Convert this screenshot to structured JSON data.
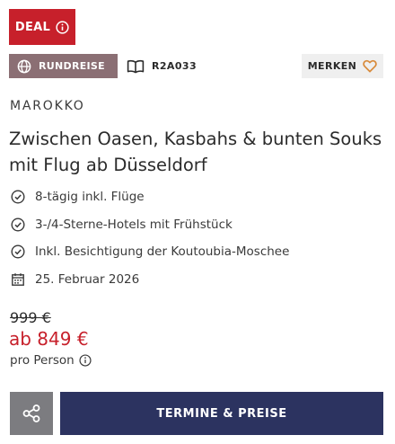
{
  "deal": {
    "label": "DEAL",
    "icon": "info-icon"
  },
  "tags": {
    "type_label": "RUNDREISE",
    "type_icon": "globe-icon",
    "code": "R2A033",
    "code_icon": "book-icon",
    "save_label": "MERKEN",
    "save_icon": "heart-icon"
  },
  "trip": {
    "country": "MAROKKO",
    "title": "Zwischen Oasen, Kasbahs & bunten Souks mit Flug ab Düsseldorf",
    "features": [
      {
        "icon": "check-circle-icon",
        "text": "8-tägig inkl. Flüge"
      },
      {
        "icon": "check-circle-icon",
        "text": "3-/4-Sterne-Hotels mit Frühstück"
      },
      {
        "icon": "check-circle-icon",
        "text": "Inkl. Besichtigung der Koutoubia-Moschee"
      },
      {
        "icon": "calendar-icon",
        "text": "25. Februar 2026"
      }
    ]
  },
  "price": {
    "old": "999 €",
    "new": "ab 849 €",
    "per": "pro Person"
  },
  "actions": {
    "share_icon": "share-icon",
    "cta_label": "TERMINE & PREISE"
  },
  "colors": {
    "deal_red": "#c7202b",
    "badge_mauve": "#8b6f74",
    "cta_navy": "#2c3360",
    "heart_orange": "#d88a3a",
    "share_gray": "#7c7c80"
  }
}
